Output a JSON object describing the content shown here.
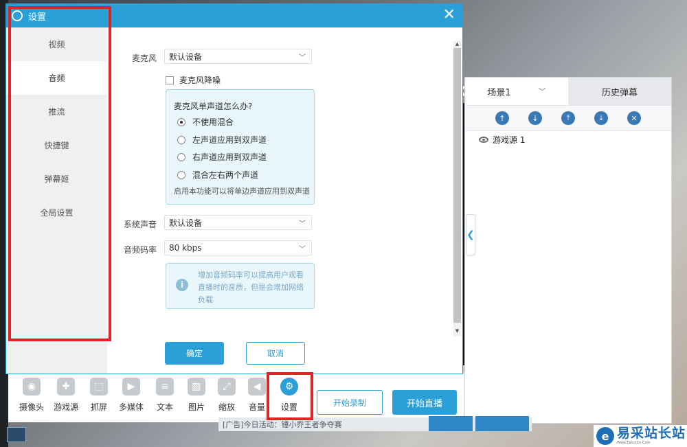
{
  "dialog": {
    "title": "设置",
    "nav": [
      {
        "label": "视频"
      },
      {
        "label": "音频"
      },
      {
        "label": "推流"
      },
      {
        "label": "快捷键"
      },
      {
        "label": "弹幕姬"
      },
      {
        "label": "全局设置"
      }
    ],
    "active_nav": "音频",
    "audio": {
      "mic_label": "麦克风",
      "mic_value": "默认设备",
      "noise_reduction_label": "麦克风降噪",
      "mono_title": "麦克风单声道怎么办?",
      "mono_options": [
        "不使用混合",
        "左声道应用到双声道",
        "右声道应用到双声道",
        "混合左右两个声道"
      ],
      "mono_selected": "不使用混合",
      "mono_note": "启用本功能可以将单边声道应用到双声道",
      "system_sound_label": "系统声音",
      "system_sound_value": "默认设备",
      "bitrate_label": "音频码率",
      "bitrate_value": "80 kbps",
      "bitrate_tip": "增加音频码率可以提高用户观看直播时的音质，但是会增加网络负载"
    },
    "ok_label": "确定",
    "cancel_label": "取消"
  },
  "scenes": {
    "tab_scene": "场景1",
    "tab_history": "历史弹幕",
    "source_name": "游戏源 1"
  },
  "toolbar": {
    "tools": [
      {
        "label": "摄像头"
      },
      {
        "label": "游戏源"
      },
      {
        "label": "抓屏"
      },
      {
        "label": "多媒体"
      },
      {
        "label": "文本"
      },
      {
        "label": "图片"
      },
      {
        "label": "缩放"
      },
      {
        "label": "音量"
      },
      {
        "label": "设置"
      }
    ],
    "record_label": "开始录制",
    "live_label": "开始直播"
  },
  "ad_text": "[广告]今日活动：锤小乔王者争夺赛",
  "brand": {
    "name": "易采站长站",
    "url": "Www.EasckCn.Com"
  },
  "colors": {
    "accent": "#2a9fd8",
    "highlight_box": "#e02323"
  }
}
